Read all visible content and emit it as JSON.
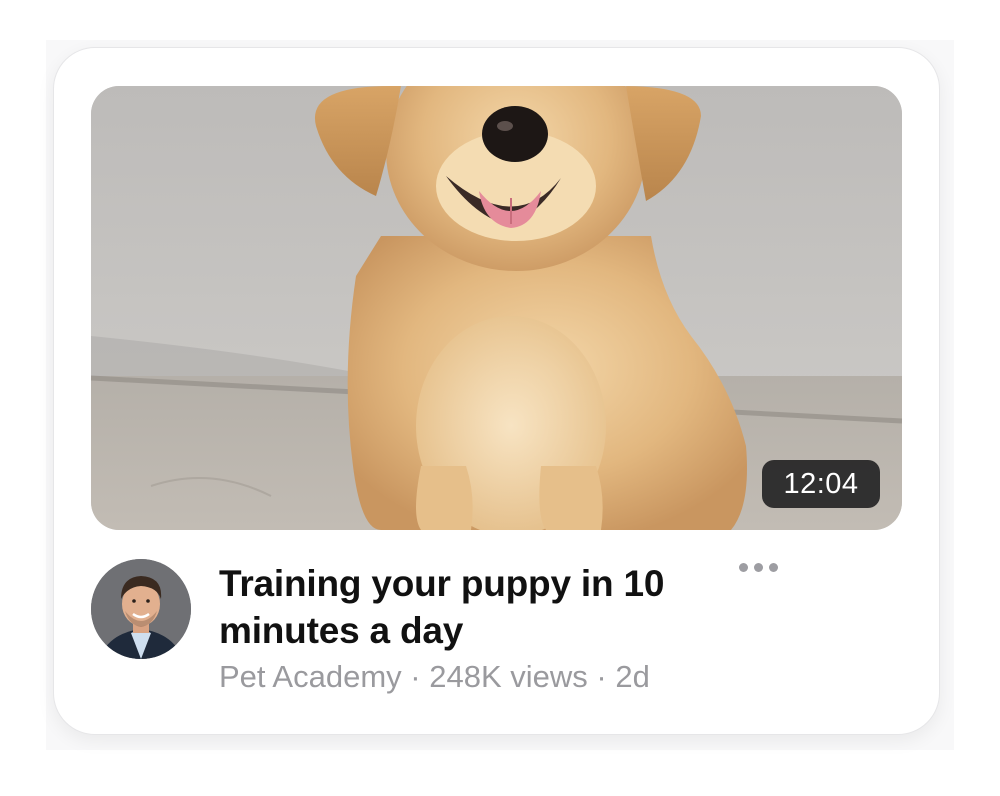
{
  "video": {
    "duration": "12:04",
    "title": "Training your puppy in 10 minutes a day",
    "thumbnail_subject": "golden retriever puppy"
  },
  "channel": {
    "name": "Pet Academy",
    "views": "248K views",
    "age": "2d",
    "separator": "·"
  },
  "actions": {
    "more_icon": "more-horizontal-icon"
  },
  "colors": {
    "card_background": "#ffffff",
    "title_text": "#111111",
    "meta_text": "#9a9a9e",
    "badge_background": "#1c1c1e"
  }
}
